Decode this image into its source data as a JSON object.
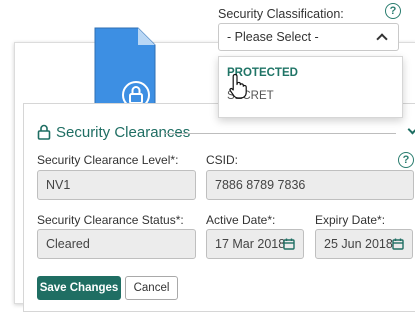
{
  "classification": {
    "label": "Security Classification:",
    "selected": "- Please Select -",
    "options": [
      "PROTECTED",
      "SECRET"
    ]
  },
  "section": {
    "title": "Security Clearances"
  },
  "form": {
    "clearance_level": {
      "label": "Security Clearance Level*:",
      "value": "NV1"
    },
    "csid": {
      "label": "CSID:",
      "value": "7886 8789 7836"
    },
    "clearance_status": {
      "label": "Security Clearance Status*:",
      "value": "Cleared"
    },
    "active_date": {
      "label": "Active Date*:",
      "value": "17 Mar 2018"
    },
    "expiry_date": {
      "label": "Expiry Date*:",
      "value": "25 Jun 2018"
    }
  },
  "buttons": {
    "save": "Save Changes",
    "cancel": "Cancel"
  },
  "icons": {
    "help": "?"
  },
  "colors": {
    "accent": "#1f6e63",
    "doc_icon": "#3d8fe3"
  }
}
